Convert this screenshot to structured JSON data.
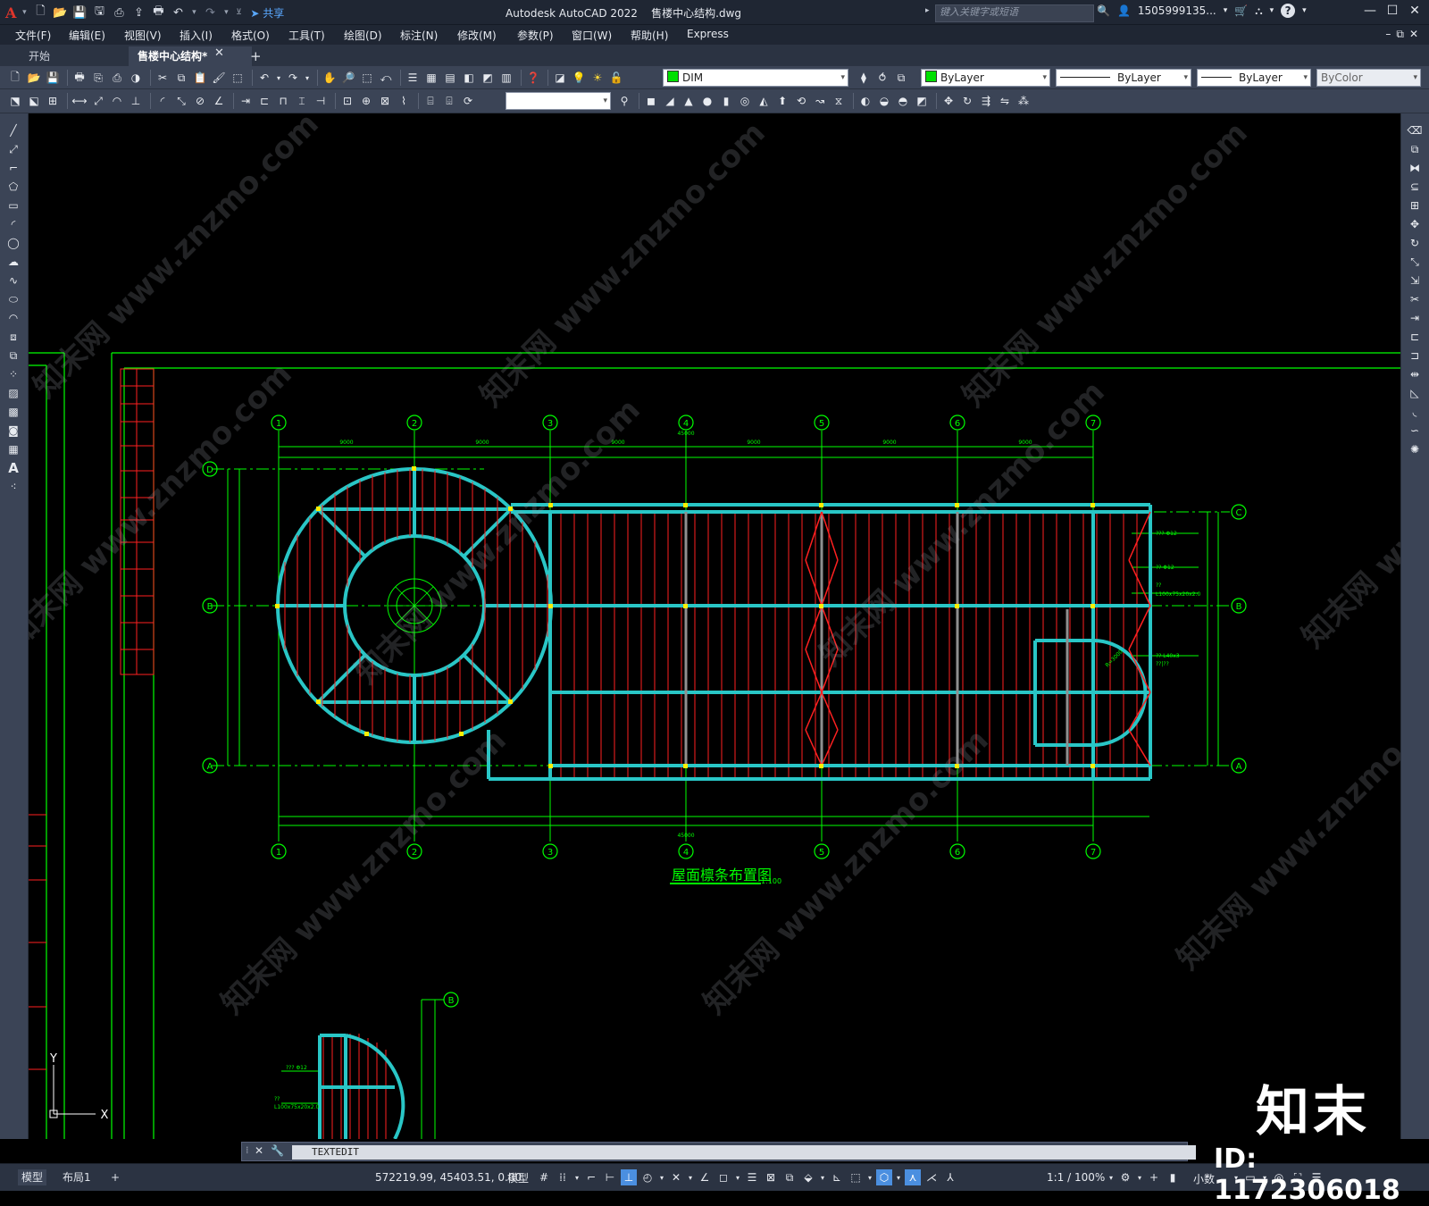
{
  "app": {
    "logo": "A",
    "share_label": "共享",
    "title": "Autodesk AutoCAD 2022    售楼中心结构.dwg",
    "search_placeholder": "键入关键字或短语",
    "user": "1505999135...",
    "help": "?"
  },
  "menu": [
    "文件(F)",
    "编辑(E)",
    "视图(V)",
    "插入(I)",
    "格式(O)",
    "工具(T)",
    "绘图(D)",
    "标注(N)",
    "修改(M)",
    "参数(P)",
    "窗口(W)",
    "帮助(H)",
    "Express"
  ],
  "tabs": {
    "start": "开始",
    "file": "售楼中心结构*",
    "add": "+"
  },
  "properties": {
    "layer": "DIM",
    "color": "ByLayer",
    "linetype": "ByLayer",
    "lineweight": "ByLayer",
    "plotstyle": "ByColor"
  },
  "drawing": {
    "axis_labels_top": [
      "1",
      "2",
      "3",
      "4",
      "5",
      "6",
      "7"
    ],
    "axis_labels_side": [
      "D",
      "B",
      "A",
      "C",
      "B",
      "A"
    ],
    "dims_top": [
      "9000",
      "9000",
      "9000",
      "9000",
      "9000",
      "9000"
    ],
    "dim_total": "45000",
    "title": "屋面檩条布置图",
    "scale_text": "1:100",
    "small_axis": "B",
    "ucs_x": "X",
    "ucs_y": "Y",
    "annotations": [
      "??? Φ12",
      "?? Φ12",
      "??",
      "L100x75x20x2.0",
      "?? L40x3",
      "??|??",
      "R=3000"
    ]
  },
  "command": {
    "text": "TEXTEDIT"
  },
  "status": {
    "tab_model": "模型",
    "tab_layout": "布局1",
    "add": "+",
    "coords": "572219.99, 45403.51, 0.00",
    "model_btn": "模型",
    "scale": "1:1 / 100%",
    "units": "小数"
  },
  "watermark": {
    "logo": "知末",
    "id": "ID: 1172306018",
    "diag": "知末网 www.znzmo.com"
  },
  "colors": {
    "grid_green": "#00ff00",
    "purlin_red": "#ff2020",
    "beam_cyan": "#29c6c6",
    "yellow": "#ffee00"
  }
}
